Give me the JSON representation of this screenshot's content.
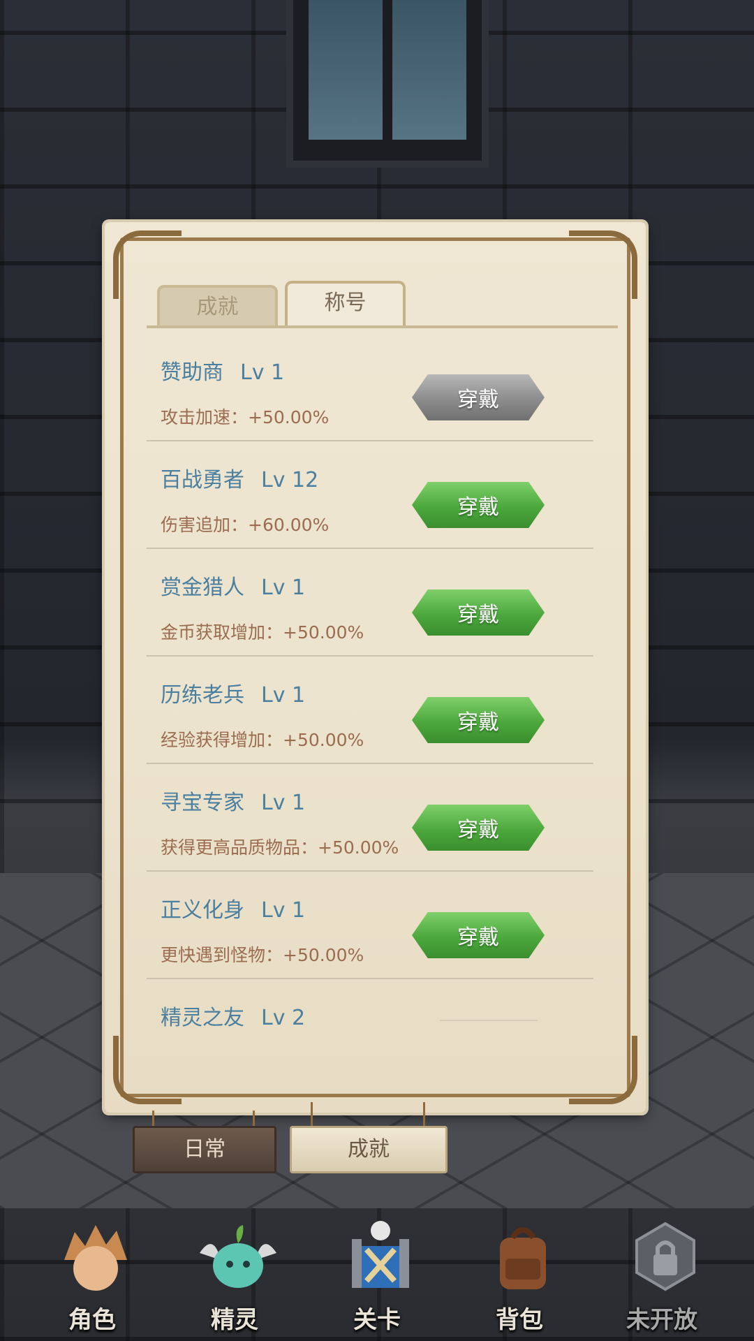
{
  "panel": {
    "tabs": [
      {
        "label": "成就",
        "active": false
      },
      {
        "label": "称号",
        "active": true
      }
    ],
    "titles": [
      {
        "name": "赞助商",
        "level": "Lv 1",
        "desc": "攻击加速：+50.00%",
        "button": "穿戴",
        "button_state": "disabled"
      },
      {
        "name": "百战勇者",
        "level": "Lv 12",
        "desc": "伤害追加：+60.00%",
        "button": "穿戴",
        "button_state": "enabled"
      },
      {
        "name": "赏金猎人",
        "level": "Lv 1",
        "desc": "金币获取增加：+50.00%",
        "button": "穿戴",
        "button_state": "enabled"
      },
      {
        "name": "历练老兵",
        "level": "Lv 1",
        "desc": "经验获得增加：+50.00%",
        "button": "穿戴",
        "button_state": "enabled"
      },
      {
        "name": "寻宝专家",
        "level": "Lv 1",
        "desc": "获得更高品质物品：+50.00%",
        "button": "穿戴",
        "button_state": "enabled"
      },
      {
        "name": "正义化身",
        "level": "Lv 1",
        "desc": "更快遇到怪物：+50.00%",
        "button": "穿戴",
        "button_state": "enabled"
      },
      {
        "name": "精灵之友",
        "level": "Lv 2"
      }
    ]
  },
  "bottom_tabs": [
    {
      "label": "日常",
      "active": false
    },
    {
      "label": "成就",
      "active": true
    }
  ],
  "nav": [
    {
      "label": "角色",
      "icon": "hero-icon"
    },
    {
      "label": "精灵",
      "icon": "spirit-icon"
    },
    {
      "label": "关卡",
      "icon": "stage-icon"
    },
    {
      "label": "背包",
      "icon": "backpack-icon"
    },
    {
      "label": "未开放",
      "icon": "locked-icon"
    }
  ],
  "colors": {
    "title_name": "#4b7f9f",
    "title_desc": "#9a6c52",
    "button_green": "#4ca83d",
    "button_gray": "#8c8c8c",
    "paper": "#efe7d3"
  }
}
